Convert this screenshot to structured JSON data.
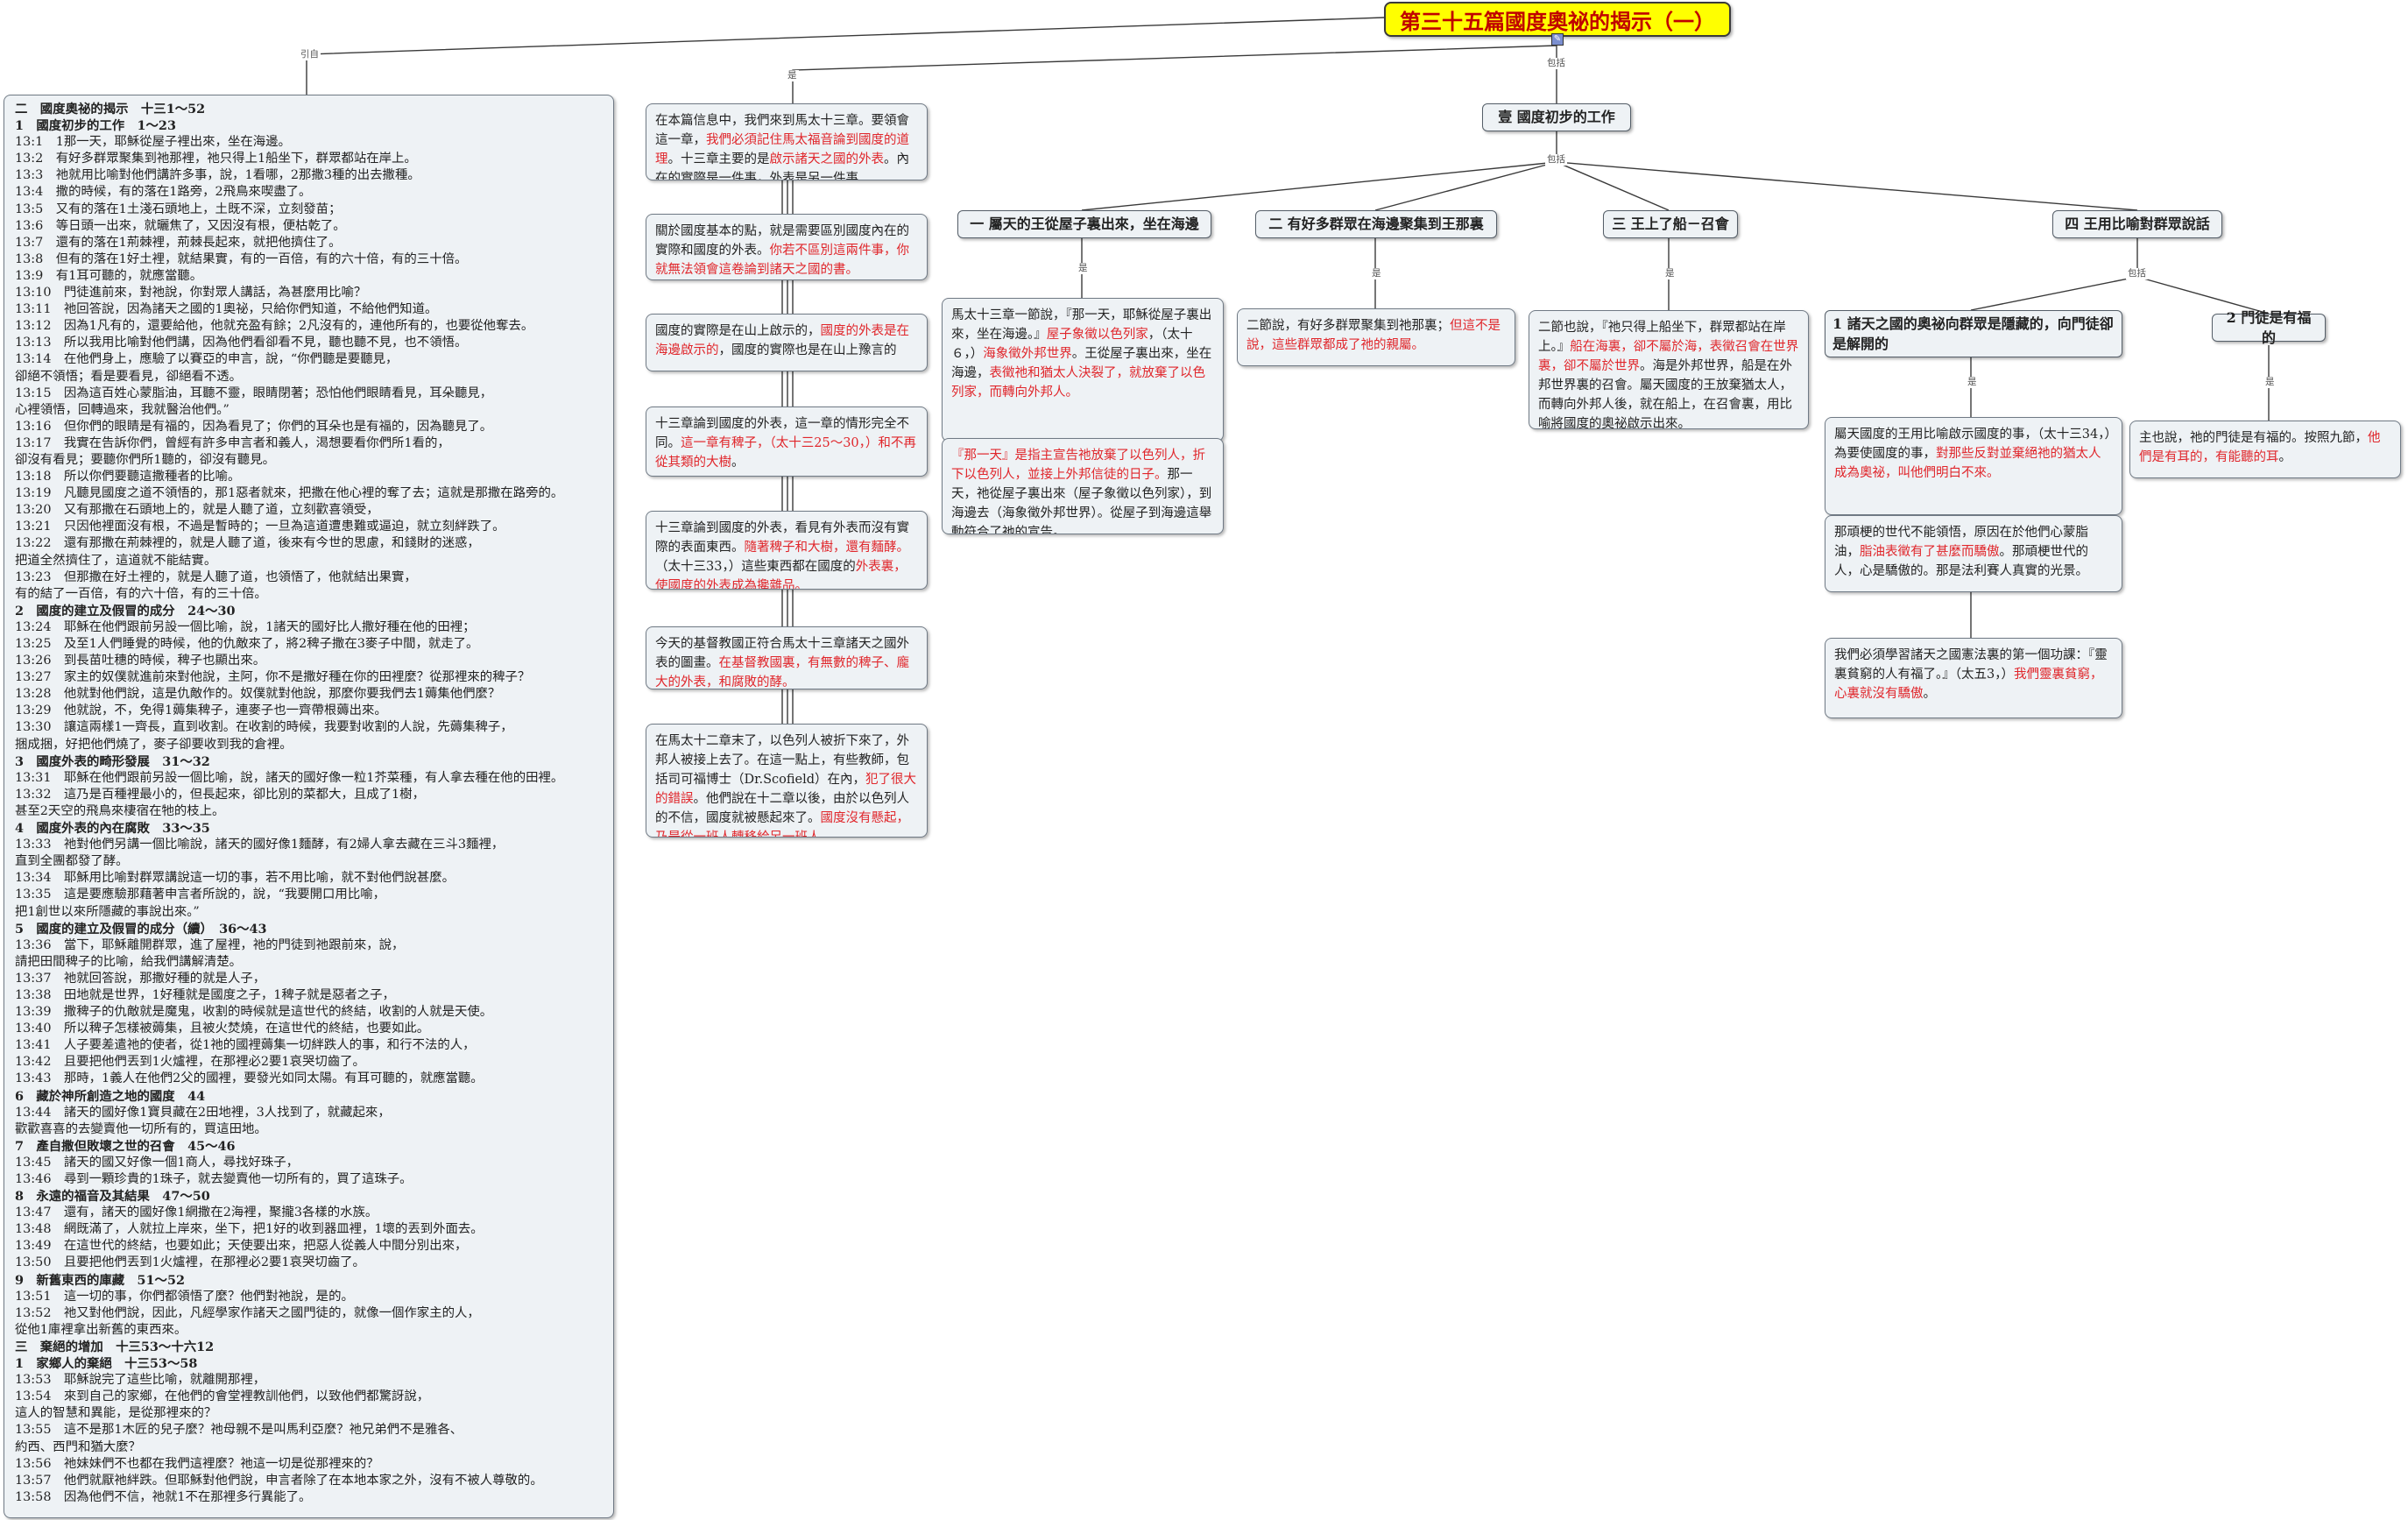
{
  "title": "第三十五篇國度奧祕的揭示（一）",
  "edge_labels": {
    "quote": "引自",
    "is": "是",
    "includes": "包括"
  },
  "outline": [
    {
      "t": "二　國度奧祕的揭示　十三1～52",
      "h": true
    },
    {
      "t": "1　國度初步的工作　1～23",
      "h": true
    },
    {
      "t": "13:1　1那一天，耶穌從屋子裡出來，坐在海邊。"
    },
    {
      "t": "13:2　有好多群眾聚集到祂那裡，祂只得上1船坐下，群眾都站在岸上。"
    },
    {
      "t": "13:3　祂就用比喻對他們講許多事，說，1看哪，2那撒3種的出去撒種。"
    },
    {
      "t": "13:4　撒的時候，有的落在1路旁，2飛鳥來喫盡了。"
    },
    {
      "t": "13:5　又有的落在1土淺石頭地上，土既不深，立刻發苗；"
    },
    {
      "t": "13:6　等日頭一出來，就曬焦了，又因沒有根，便枯乾了。"
    },
    {
      "t": "13:7　還有的落在1荊棘裡，荊棘長起來，就把他擠住了。"
    },
    {
      "t": "13:8　但有的落在1好土裡，就結果實，有的一百倍，有的六十倍，有的三十倍。"
    },
    {
      "t": "13:9　有1耳可聽的，就應當聽。"
    },
    {
      "t": "13:10　門徒進前來，對祂說，你對眾人講話，為甚麼用比喻？"
    },
    {
      "t": "13:11　祂回答說，因為諸天之國的1奧祕，只給你們知道，不給他們知道。"
    },
    {
      "t": "13:12　因為1凡有的，還要給他，他就充盈有餘；2凡沒有的，連他所有的，也要從他奪去。"
    },
    {
      "t": "13:13　所以我用比喻對他們講，因為他們看卻看不見，聽也聽不見，也不領悟。"
    },
    {
      "t": "13:14　在他們身上，應驗了以賽亞的申言，說，“你們聽是要聽見，"
    },
    {
      "t": "卻絕不領悟；看是要看見，卻絕看不透。"
    },
    {
      "t": "13:15　因為這百姓心蒙脂油，耳聽不靈，眼睛閉著；恐怕他們眼睛看見，耳朵聽見，"
    },
    {
      "t": "心裡領悟，回轉過來，我就醫治他們。”"
    },
    {
      "t": "13:16　但你們的眼睛是有福的，因為看見了；你們的耳朵也是有福的，因為聽見了。"
    },
    {
      "t": "13:17　我實在告訴你們，曾經有許多申言者和義人，渴想要看你們所1看的，"
    },
    {
      "t": "卻沒有看見；要聽你們所1聽的，卻沒有聽見。"
    },
    {
      "t": "13:18　所以你們要聽這撒種者的比喻。"
    },
    {
      "t": "13:19　凡聽見國度之道不領悟的，那1惡者就來，把撒在他心裡的奪了去；這就是那撒在路旁的。"
    },
    {
      "t": "13:20　又有那撒在石頭地上的，就是人聽了道，立刻歡喜領受，"
    },
    {
      "t": "13:21　只因他裡面沒有根，不過是暫時的；一旦為這道遭患難或逼迫，就立刻絆跌了。"
    },
    {
      "t": "13:22　還有那撒在荊棘裡的，就是人聽了道，後來有今世的思慮，和錢財的迷惑，"
    },
    {
      "t": "把道全然擠住了，這道就不能結實。"
    },
    {
      "t": "13:23　但那撒在好土裡的，就是人聽了道，也領悟了，他就結出果實，"
    },
    {
      "t": "有的結了一百倍，有的六十倍，有的三十倍。"
    },
    {
      "t": "2　國度的建立及假冒的成分　24～30",
      "h": true
    },
    {
      "t": "13:24　耶穌在他們跟前另設一個比喻，說，1諸天的國好比人撒好種在他的田裡；"
    },
    {
      "t": "13:25　及至1人們睡覺的時候，他的仇敵來了，將2稗子撒在3麥子中間，就走了。"
    },
    {
      "t": "13:26　到長苗吐穗的時候，稗子也顯出來。"
    },
    {
      "t": "13:27　家主的奴僕就進前來對他說，主阿，你不是撒好種在你的田裡麼？從那裡來的稗子？"
    },
    {
      "t": "13:28　他就對他們說，這是仇敵作的。奴僕就對他說，那麼你要我們去1薅集他們麼？"
    },
    {
      "t": "13:29　他就說，不，免得1薅集稗子，連麥子也一齊帶根薅出來。"
    },
    {
      "t": "13:30　讓這兩樣1一齊長，直到收割。在收割的時候，我要對收割的人說，先薅集稗子，"
    },
    {
      "t": "捆成捆，好把他們燒了，麥子卻要收到我的倉裡。"
    },
    {
      "t": "3　國度外表的畸形發展　31～32",
      "h": true
    },
    {
      "t": "13:31　耶穌在他們跟前另設一個比喻，說，諸天的國好像一粒1芥菜種，有人拿去種在他的田裡。"
    },
    {
      "t": "13:32　這乃是百種裡最小的，但長起來，卻比別的菜都大，且成了1樹，"
    },
    {
      "t": "甚至2天空的飛鳥來棲宿在牠的枝上。"
    },
    {
      "t": "4　國度外表的內在腐敗　33～35",
      "h": true
    },
    {
      "t": "13:33　祂對他們另講一個比喻說，諸天的國好像1麵酵，有2婦人拿去藏在三斗3麵裡，"
    },
    {
      "t": "直到全團都發了酵。"
    },
    {
      "t": "13:34　耶穌用比喻對群眾講說這一切的事，若不用比喻，就不對他們說甚麼。"
    },
    {
      "t": "13:35　這是要應驗那藉著申言者所說的，說，“我要開口用比喻，"
    },
    {
      "t": "把1創世以來所隱藏的事說出來。”"
    },
    {
      "t": "5　國度的建立及假冒的成分（續）　36～43",
      "h": true
    },
    {
      "t": "13:36　當下，耶穌離開群眾，進了屋裡，祂的門徒到祂跟前來，說，"
    },
    {
      "t": "請把田間稗子的比喻，給我們講解清楚。"
    },
    {
      "t": "13:37　祂就回答說，那撒好種的就是人子，"
    },
    {
      "t": "13:38　田地就是世界，1好種就是國度之子，1稗子就是惡者之子，"
    },
    {
      "t": "13:39　撒稗子的仇敵就是魔鬼，收割的時候就是這世代的終結，收割的人就是天使。"
    },
    {
      "t": "13:40　所以稗子怎樣被薅集，且被火焚燒，在這世代的終結，也要如此。"
    },
    {
      "t": "13:41　人子要差遣祂的使者，從1祂的國裡薅集一切絆跌人的事，和行不法的人，"
    },
    {
      "t": "13:42　且要把他們丟到1火爐裡，在那裡必2要1哀哭切齒了。"
    },
    {
      "t": "13:43　那時，1義人在他們2父的國裡，要發光如同太陽。有耳可聽的，就應當聽。"
    },
    {
      "t": "6　藏於神所創造之地的國度　44",
      "h": true
    },
    {
      "t": "13:44　諸天的國好像1寶貝藏在2田地裡，3人找到了，就藏起來，"
    },
    {
      "t": "歡歡喜喜的去變賣他一切所有的，買這田地。"
    },
    {
      "t": "7　產自撒但敗壞之世的召會　45～46",
      "h": true
    },
    {
      "t": "13:45　諸天的國又好像一個1商人，尋找好珠子，"
    },
    {
      "t": "13:46　尋到一顆珍貴的1珠子，就去變賣他一切所有的，買了這珠子。"
    },
    {
      "t": "8　永遠的福音及其結果　47～50",
      "h": true
    },
    {
      "t": "13:47　還有，諸天的國好像1網撒在2海裡，聚攏3各樣的水族。"
    },
    {
      "t": "13:48　網既滿了，人就拉上岸來，坐下，把1好的收到器皿裡，1壞的丟到外面去。"
    },
    {
      "t": "13:49　在這世代的終結，也要如此；天使要出來，把惡人從義人中間分別出來，"
    },
    {
      "t": "13:50　且要把他們丟到1火爐裡，在那裡必2要1哀哭切齒了。"
    },
    {
      "t": "9　新舊東西的庫藏　51～52",
      "h": true
    },
    {
      "t": "13:51　這一切的事，你們都領悟了麼？他們對祂說，是的。"
    },
    {
      "t": "13:52　祂又對他們說，因此，凡經學家作諸天之國門徒的，就像一個作家主的人，"
    },
    {
      "t": "從他1庫裡拿出新舊的東西來。"
    },
    {
      "t": "三　棄絕的增加　十三53～十六12",
      "h": true
    },
    {
      "t": "1　家鄉人的棄絕　十三53～58",
      "h": true
    },
    {
      "t": "13:53　耶穌說完了這些比喻，就離開那裡，"
    },
    {
      "t": "13:54　來到自己的家鄉，在他們的會堂裡教訓他們，以致他們都驚訝說，"
    },
    {
      "t": "這人的智慧和異能，是從那裡來的？"
    },
    {
      "t": "13:55　這不是那1木匠的兒子麼？祂母親不是叫馬利亞麼？祂兄弟們不是雅各、"
    },
    {
      "t": "約西、西門和猶大麼？"
    },
    {
      "t": "13:56　祂妹妹們不也都在我們這裡麼？祂這一切是從那裡來的？"
    },
    {
      "t": "13:57　他們就厭祂絆跌。但耶穌對他們說，申言者除了在本地本家之外，沒有不被人尊敬的。"
    },
    {
      "t": "13:58　因為他們不信，祂就1不在那裡多行異能了。"
    }
  ],
  "middle_notes": [
    [
      {
        "t": "在本篇信息中，我們來到馬太十三章。要領會這一章，"
      },
      {
        "t": "我們必須記住馬太福音論到國度的道理",
        "r": true
      },
      {
        "t": "。十三章主要的是"
      },
      {
        "t": "啟示諸天之國的外表",
        "r": true
      },
      {
        "t": "。內在的實際是一件事，外表是另一件事"
      }
    ],
    [
      {
        "t": "關於國度基本的點，就是需要區別國度內在的實際和國度的外表。"
      },
      {
        "t": "你若不區別這兩件事，你就無法領會這卷論到諸天之國的書。",
        "r": true
      }
    ],
    [
      {
        "t": "國度的實際是在山上啟示的，"
      },
      {
        "t": "國度的外表是在海邊啟示的",
        "r": true
      },
      {
        "t": "，國度的實際也是在山上豫言的"
      }
    ],
    [
      {
        "t": "十三章論到國度的外表，這一章的情形完全不同。"
      },
      {
        "t": "這一章有稗子，（太十三25～30，）和不再從其類的大樹",
        "r": true
      },
      {
        "t": "。"
      }
    ],
    [
      {
        "t": "十三章論到國度的外表，看見有外表而沒有實際的表面東西。"
      },
      {
        "t": "隨著稗子和大樹，還有麵酵。",
        "r": true
      },
      {
        "t": "（太十三33，）這些東西都在國度的"
      },
      {
        "t": "外表裏，使國度的外表成為攙雜品。",
        "r": true
      }
    ],
    [
      {
        "t": "今天的基督教國正符合馬太十三章諸天之國外表的圖畫。"
      },
      {
        "t": "在基督教國裏，有無數的稗子、龐大的外表，和腐敗的酵。",
        "r": true
      }
    ],
    [
      {
        "t": "在馬太十二章末了，以色列人被折下來了，外邦人被接上去了。在這一點上，有些教師，包括司可福博士（Dr.Scofield）在內，"
      },
      {
        "t": "犯了很大的錯誤",
        "r": true
      },
      {
        "t": "。他們說在十二章以後，由於以色列人的不信，國度就被懸起來了。"
      },
      {
        "t": "國度沒有懸起，乃是從一班人轉移給另一班人。",
        "r": true
      }
    ]
  ],
  "main_node": "壹 國度初步的工作",
  "branches": [
    {
      "title": "一 屬天的王從屋子裏出來，坐在海邊",
      "notes": [
        [
          {
            "t": "馬太十三章一節說，『那一天，耶穌從屋子裏出來，坐在海邊。』"
          },
          {
            "t": "屋子象徵以色列家",
            "r": true
          },
          {
            "t": "，（太十６，）"
          },
          {
            "t": "海象徵外邦世界",
            "r": true
          },
          {
            "t": "。王從屋子裏出來，坐在海邊，"
          },
          {
            "t": "表徵祂和猶太人決裂了，就放棄了以色列家，而轉向外邦人。",
            "r": true
          }
        ],
        [
          {
            "t": "『那一天』是指主宣告祂放棄了以色列人，折下以色列人，並接上外邦信徒的日子。",
            "r": true
          },
          {
            "t": "那一天，祂從屋子裏出來（屋子象徵以色列家），到海邊去（海象徵外邦世界）。從屋子到海邊這舉動符合了祂的宣告。"
          }
        ]
      ]
    },
    {
      "title": "二 有好多群眾在海邊聚集到王那裏",
      "notes": [
        [
          {
            "t": "二節說，有好多群眾聚集到祂那裏；"
          },
          {
            "t": "但這不是說，這些群眾都成了祂的親屬。",
            "r": true
          }
        ]
      ]
    },
    {
      "title": "三 王上了船－召會",
      "notes": [
        [
          {
            "t": "二節也說，『祂只得上船坐下，群眾都站在岸上。』"
          },
          {
            "t": "船在海裏，卻不屬於海，表徵召會在世界裏，卻不屬於世界",
            "r": true
          },
          {
            "t": "。海是外邦世界，船是在外邦世界裏的召會。屬天國度的王放棄猶太人，而轉向外邦人後，就在船上，在召會裏，用比喻將國度的奧祕啟示出來。"
          }
        ]
      ]
    },
    {
      "title": "四 王用比喻對群眾說話",
      "subs": [
        {
          "title": "1 諸天之國的奧祕向群眾是隱藏的，向門徒卻是解開的",
          "notes": [
            [
              {
                "t": "屬天國度的王用比喻啟示國度的事，（太十三34，）為要使國度的事，"
              },
              {
                "t": "對那些反對並棄絕祂的猶太人成為奧祕，叫他們明白不來。",
                "r": true
              }
            ],
            [
              {
                "t": "那頑梗的世代不能領悟，原因在於他們心蒙脂油，"
              },
              {
                "t": "脂油表徵有了甚麼而驕傲",
                "r": true
              },
              {
                "t": "。那頑梗世代的人，心是驕傲的。那是法利賽人真實的光景。"
              }
            ],
            [
              {
                "t": "我們必須學習諸天之國憲法裏的第一個功課：『靈裏貧窮的人有福了。』（太五3，）"
              },
              {
                "t": "我們靈裏貧窮，心裏就沒有驕傲",
                "r": true
              },
              {
                "t": "。"
              }
            ]
          ]
        },
        {
          "title": "2 門徒是有福的",
          "notes": [
            [
              {
                "t": "主也說，祂的門徒是有福的。按照九節，"
              },
              {
                "t": "他們是有耳的，有能聽的耳",
                "r": true
              },
              {
                "t": "。"
              }
            ]
          ]
        }
      ]
    }
  ]
}
